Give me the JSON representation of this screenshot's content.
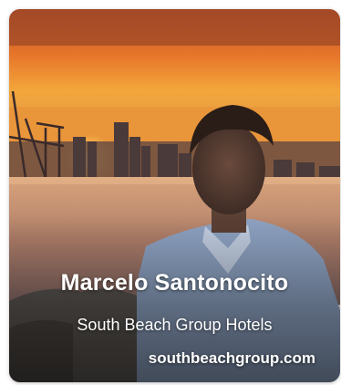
{
  "profile": {
    "name": "Marcelo Santonocito",
    "company": "South Beach Group Hotels",
    "website": "southbeachgroup.com"
  },
  "photo": {
    "subject": "man-portrait-at-sunset-harbor",
    "sky_color": "#e98a2c",
    "water_color": "#b9876b"
  }
}
